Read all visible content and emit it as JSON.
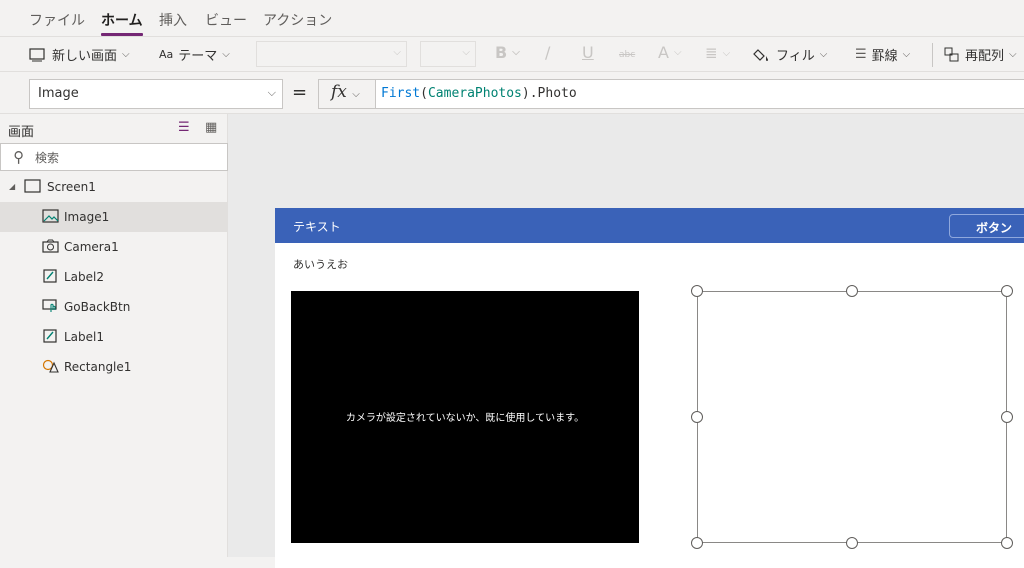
{
  "menu": {
    "items": [
      "ファイル",
      "ホーム",
      "挿入",
      "ビュー",
      "アクション"
    ],
    "active": "ホーム"
  },
  "toolbar": {
    "new_screen": "新しい画面",
    "theme": "テーマ",
    "bold": "B",
    "italic": "/",
    "underline": "U",
    "strike": "abc",
    "font_color": "A",
    "fill": "フィル",
    "border": "罫線",
    "reorder": "再配列"
  },
  "formula_bar": {
    "property": "Image",
    "equals": "=",
    "fx_label": "fx",
    "formula_fn": "First",
    "formula_open": "(",
    "formula_ref": "CameraPhotos",
    "formula_rest": ").Photo"
  },
  "tree_view": {
    "title": "画面",
    "search_placeholder": "検索",
    "screen": "Screen1",
    "controls": [
      {
        "name": "Image1",
        "icon": "image-icon",
        "selected": true
      },
      {
        "name": "Camera1",
        "icon": "camera-icon",
        "selected": false
      },
      {
        "name": "Label2",
        "icon": "label-icon",
        "selected": false
      },
      {
        "name": "GoBackBtn",
        "icon": "button-icon",
        "selected": false
      },
      {
        "name": "Label1",
        "icon": "label-icon",
        "selected": false
      },
      {
        "name": "Rectangle1",
        "icon": "shapes-icon",
        "selected": false
      }
    ]
  },
  "app": {
    "header_text": "テキスト",
    "button_label": "ボタン",
    "label_text": "あいうえお",
    "camera_message": "カメラが設定されていないか、既に使用しています。"
  },
  "colors": {
    "accent": "#742774",
    "app_header": "#3a62b8"
  }
}
